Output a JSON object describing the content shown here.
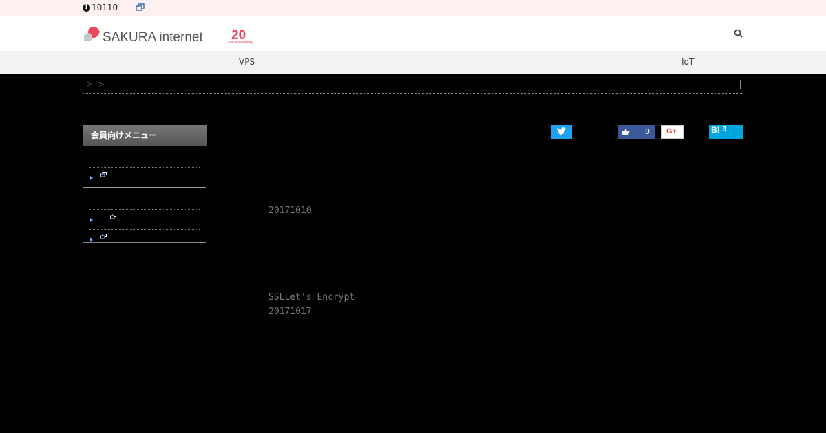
{
  "topbar": {
    "notice_text": "10110",
    "info_icon": "info-icon",
    "external_icon": "external-link-icon"
  },
  "header": {
    "logo_text": "SAKURA internet",
    "anniversary_number": "20",
    "anniversary_sub": "20th Anniversary",
    "search_icon": "search-icon"
  },
  "nav": {
    "items": [
      {
        "label": "VPS"
      },
      {
        "label": "IoT"
      }
    ]
  },
  "breadcrumb": {
    "separators": [
      ">",
      ">"
    ]
  },
  "social": {
    "facebook_count": "0",
    "hatena_label": "B!",
    "hatena_count": "3",
    "google_label": "G+"
  },
  "sidebar": {
    "title": "会員向けメニュー"
  },
  "content": {
    "date1": "20171010",
    "article_title": "SSLLet's Encrypt",
    "date2": "20171017"
  },
  "colors": {
    "brand": "#e8475f",
    "twitter": "#1da1f2",
    "facebook": "#3b5998",
    "hatena": "#00a4de"
  }
}
